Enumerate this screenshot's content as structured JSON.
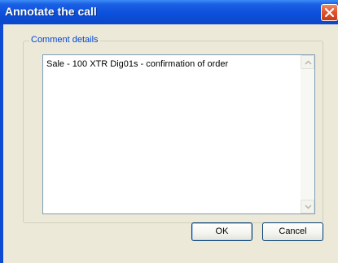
{
  "window": {
    "title": "Annotate the call"
  },
  "comment_group": {
    "label": "Comment details",
    "text": "Sale - 100 XTR Dig01s - confirmation of order"
  },
  "buttons": {
    "ok_label": "OK",
    "cancel_label": "Cancel"
  },
  "icons": {
    "close": "close-icon",
    "scroll_up": "chevron-up-icon",
    "scroll_down": "chevron-down-icon"
  },
  "colors": {
    "titlebar": "#0c50dc",
    "group_label": "#0046d5",
    "dialog_background": "#ece9d8",
    "close_button": "#e0552e"
  }
}
